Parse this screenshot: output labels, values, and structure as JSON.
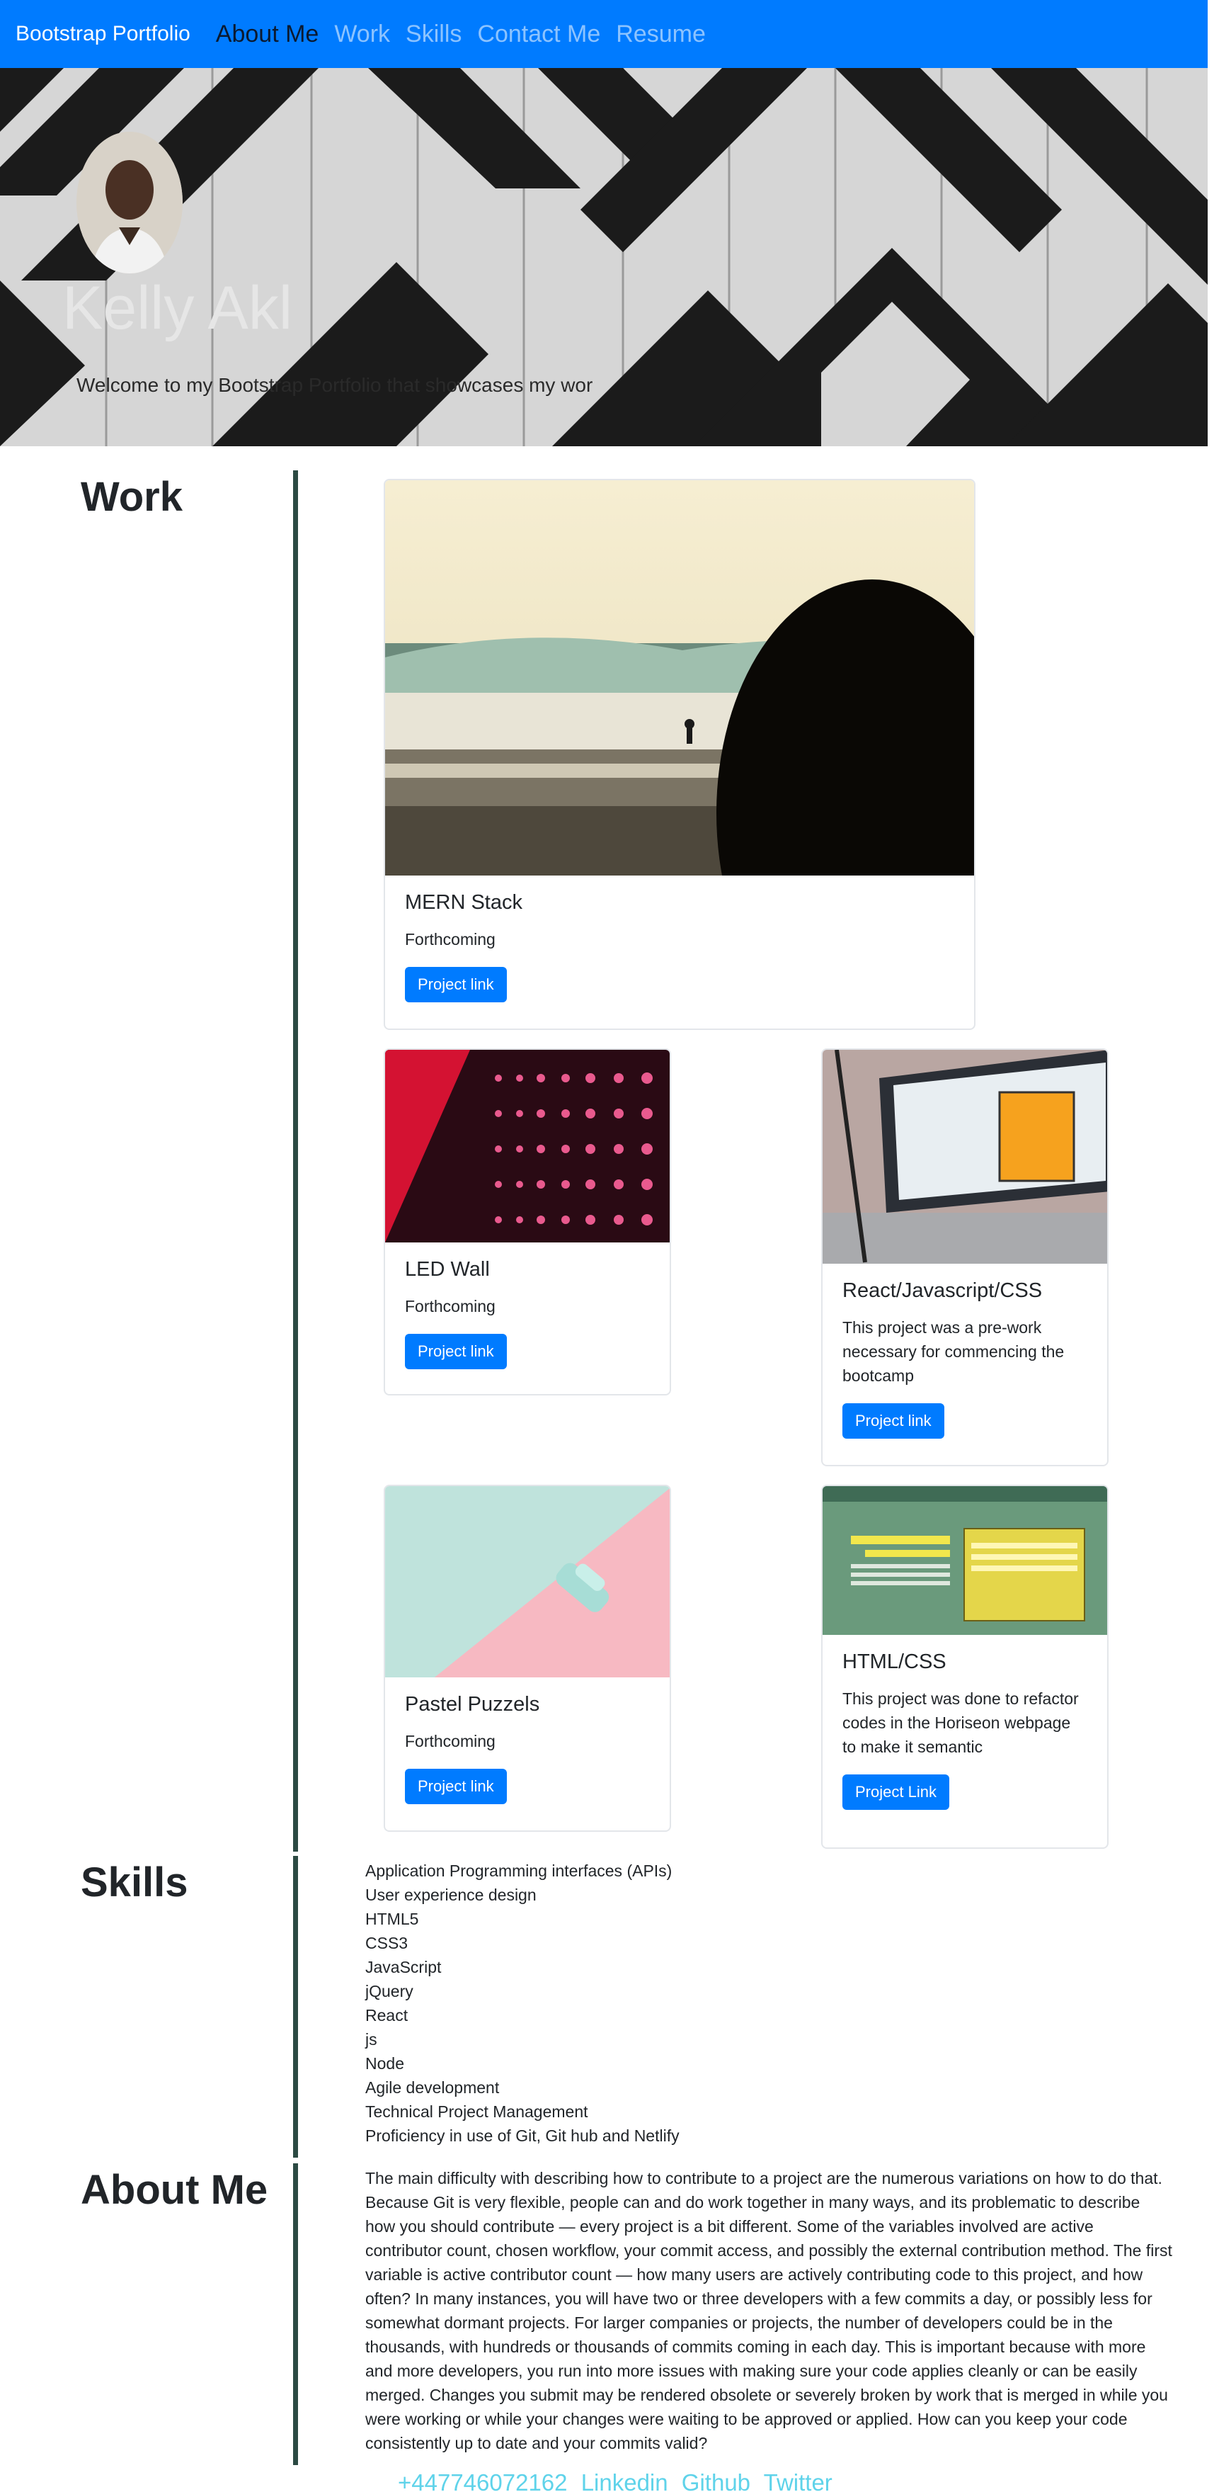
{
  "navbar": {
    "brand": "Bootstrap Portfolio",
    "links": [
      {
        "label": "About Me"
      },
      {
        "label": "Work"
      },
      {
        "label": "Skills"
      },
      {
        "label": "Contact Me"
      },
      {
        "label": "Resume"
      }
    ]
  },
  "hero": {
    "name": "Kelly Akl",
    "intro": "Welcome to my Bootstrap Portfolio that showcases my works"
  },
  "work": {
    "title": "Work",
    "cards": [
      {
        "title": "MERN Stack",
        "text": "Forthcoming",
        "button": "Project link"
      },
      {
        "title": "LED Wall",
        "text": "Forthcoming",
        "button": "Project link"
      },
      {
        "title": "React/Javascript/CSS",
        "text": "This project was a pre-work necessary for commencing the bootcamp",
        "button": "Project link"
      },
      {
        "title": "Pastel Puzzels",
        "text": "Forthcoming",
        "button": "Project link"
      },
      {
        "title": "HTML/CSS",
        "text": "This project was done to refactor codes in the Horiseon webpage to make it semantic",
        "button": "Project Link"
      }
    ]
  },
  "skills": {
    "title": "Skills",
    "items": [
      "Application Programming interfaces (APIs)",
      "User experience design",
      "HTML5",
      "CSS3",
      "JavaScript",
      "jQuery",
      "React",
      "js",
      "Node",
      "Agile development",
      "Technical Project Management",
      "Proficiency in use of Git, Git hub and Netlify"
    ]
  },
  "about": {
    "title": "About Me",
    "text": "The main difficulty with describing how to contribute to a project are the numerous variations on how to do that. Because Git is very flexible, people can and do work together in many ways, and its problematic to describe how you should contribute — every project is a bit different. Some of the variables involved are active contributor count, chosen workflow, your commit access, and possibly the external contribution method. The first variable is active contributor count — how many users are actively contributing code to this project, and how often? In many instances, you will have two or three developers with a few commits a day, or possibly less for somewhat dormant projects. For larger companies or projects, the number of developers could be in the thousands, with hundreds or thousands of commits coming in each day. This is important because with more and more developers, you run into more issues with making sure your code applies cleanly or can be easily merged. Changes you submit may be rendered obsolete or severely broken by work that is merged in while you were working or while your changes were waiting to be approved or applied. How can you keep your code consistently up to date and your commits valid?"
  },
  "contact": {
    "phone": "+447746072162",
    "linkedin": "Linkedin",
    "github": "Github",
    "twitter": "Twitter"
  },
  "colors": {
    "navbar": "#007bff",
    "button": "#007bff",
    "divider": "#2c4a43",
    "contact_link": "#5fd3ea"
  }
}
